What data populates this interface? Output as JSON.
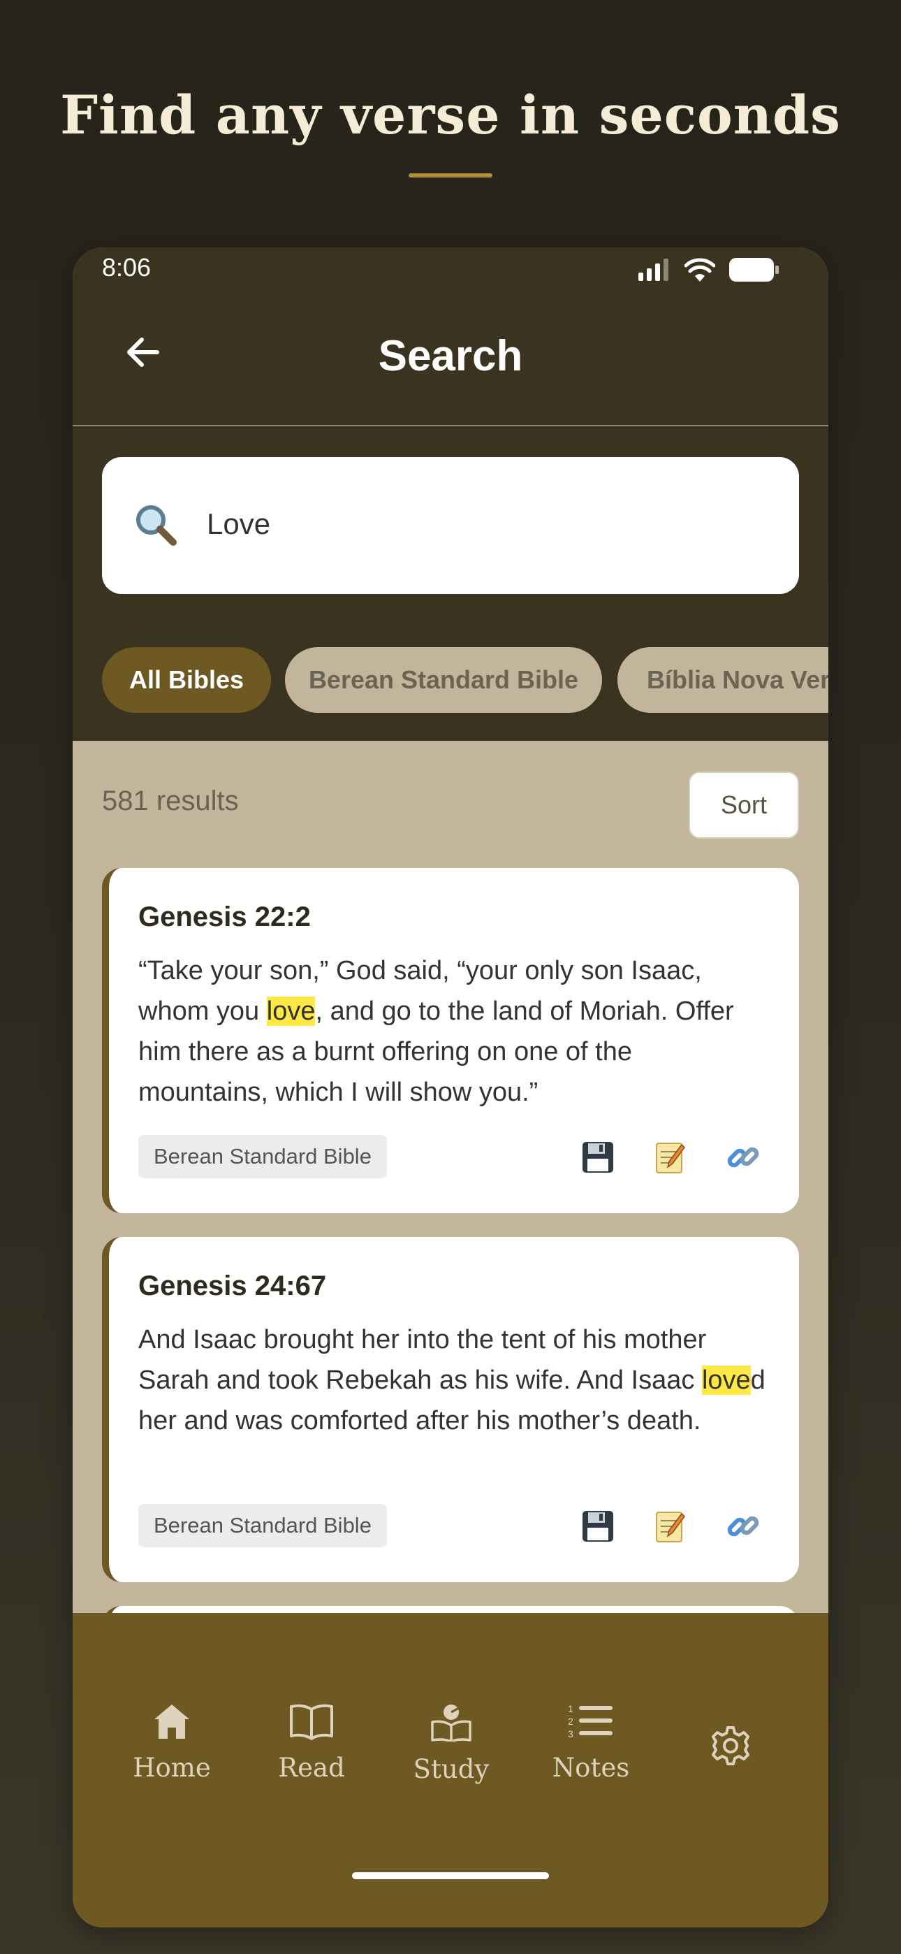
{
  "headline": "Find any verse in seconds",
  "status_bar": {
    "time": "8:06"
  },
  "nav": {
    "title": "Search"
  },
  "search": {
    "value": "Love"
  },
  "filters": [
    "All Bibles",
    "Berean Standard Bible",
    "Bíblia Nova Vers"
  ],
  "results": {
    "count_text": "581 results",
    "sort_label": "Sort",
    "items": [
      {
        "reference": "Genesis 22:2",
        "before": "“Take your son,” God said, “your only son Isaac, whom you ",
        "match": "love",
        "after": ", and go to the land of Moriah. Offer him there as a burnt offering on one of the mountains, which I will show you.”",
        "version": "Berean Standard Bible"
      },
      {
        "reference": "Genesis 24:67",
        "before": "And Isaac brought her into the tent of his mother Sarah and took Rebekah as his wife. And Isaac ",
        "match": "love",
        "after": "d her and was comforted after his mother’s death.",
        "version": "Berean Standard Bible"
      }
    ]
  },
  "tabbar": {
    "home": "Home",
    "read": "Read",
    "study": "Study",
    "notes": "Notes"
  },
  "colors": {
    "accent": "#6e5923",
    "highlight": "#ffe843",
    "header_bg": "#39331f",
    "content_bg": "#c2b59c"
  },
  "icons": {
    "card_actions": [
      "save-icon",
      "note-icon",
      "link-icon"
    ],
    "tabs": [
      "home-icon",
      "book-icon",
      "study-icon",
      "list-icon",
      "gear-icon"
    ]
  }
}
